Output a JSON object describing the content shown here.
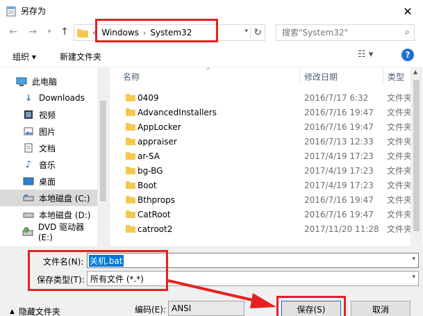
{
  "window": {
    "title": "另存为",
    "close_glyph": "✕"
  },
  "address": {
    "prefix": "«",
    "crumbs": [
      "Windows",
      "System32"
    ],
    "separator": "›"
  },
  "search": {
    "placeholder": "搜索\"System32\""
  },
  "toolbar": {
    "organize": "组织 ▾",
    "new_folder": "新建文件夹"
  },
  "sidebar": {
    "items": [
      {
        "label": "此电脑",
        "icon": "computer-icon"
      },
      {
        "label": "Downloads",
        "icon": "download-icon"
      },
      {
        "label": "视频",
        "icon": "video-icon"
      },
      {
        "label": "图片",
        "icon": "picture-icon"
      },
      {
        "label": "文档",
        "icon": "document-icon"
      },
      {
        "label": "音乐",
        "icon": "music-icon"
      },
      {
        "label": "桌面",
        "icon": "desktop-icon"
      },
      {
        "label": "本地磁盘 (C:)",
        "icon": "drive-icon",
        "selected": true
      },
      {
        "label": "本地磁盘 (D:)",
        "icon": "drive-icon"
      },
      {
        "label": "DVD 驱动器 (E:)",
        "icon": "dvd-icon"
      }
    ]
  },
  "columns": {
    "name": "名称",
    "date": "修改日期",
    "type": "类型"
  },
  "files": [
    {
      "name": "0409",
      "date": "2016/7/17 6:32",
      "type": "文件夹"
    },
    {
      "name": "AdvancedInstallers",
      "date": "2016/7/16 19:47",
      "type": "文件夹"
    },
    {
      "name": "AppLocker",
      "date": "2016/7/16 19:47",
      "type": "文件夹"
    },
    {
      "name": "appraiser",
      "date": "2016/7/13 12:33",
      "type": "文件夹"
    },
    {
      "name": "ar-SA",
      "date": "2017/4/19 17:23",
      "type": "文件夹"
    },
    {
      "name": "bg-BG",
      "date": "2017/4/19 17:23",
      "type": "文件夹"
    },
    {
      "name": "Boot",
      "date": "2017/4/19 17:23",
      "type": "文件夹"
    },
    {
      "name": "Bthprops",
      "date": "2016/7/16 19:47",
      "type": "文件夹"
    },
    {
      "name": "CatRoot",
      "date": "2016/7/16 19:47",
      "type": "文件夹"
    },
    {
      "name": "catroot2",
      "date": "2017/11/20 11:28",
      "type": "文件夹"
    }
  ],
  "form": {
    "filename_label": "文件名(N):",
    "filename_value": "关机.bat",
    "filetype_label": "保存类型(T):",
    "filetype_value": "所有文件  (*.*)",
    "hide_folders": "隐藏文件夹",
    "encoding_label": "编码(E):",
    "encoding_value": "ANSI",
    "save": "保存(S)",
    "cancel": "取消"
  },
  "colors": {
    "annotation": "#e62020",
    "folder": "#f5c94e",
    "accent": "#0078d7"
  }
}
